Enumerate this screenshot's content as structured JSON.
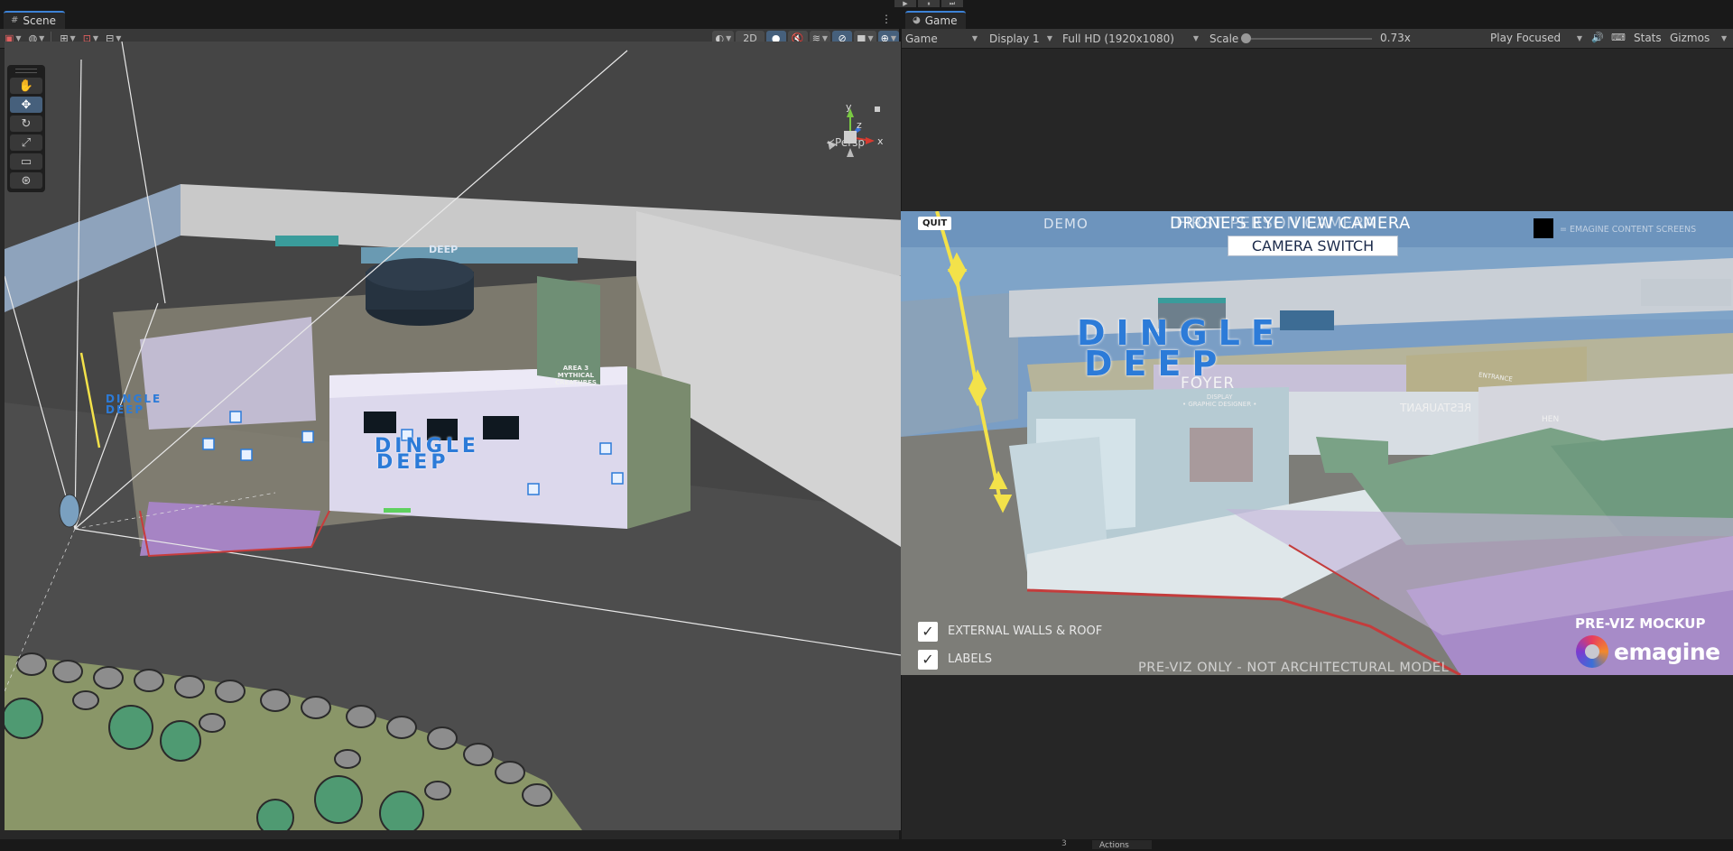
{
  "play_controls": [
    "▶",
    "⏸",
    "⏭"
  ],
  "scene": {
    "tab_label": "Scene",
    "tab_icon": "grid-icon",
    "toolbar": {
      "mode_2d": "2D"
    },
    "tools": [
      "hand-icon",
      "move-icon",
      "rotate-icon",
      "scale-icon",
      "rect-icon",
      "transform-icon"
    ],
    "gizmo": {
      "y": "y",
      "z": "z",
      "x": "x",
      "projection": "≺Persp"
    },
    "in_scene_text": {
      "sign_top": "DEEP",
      "dingle_deep": [
        "DINGLE",
        "DEEP"
      ],
      "area3": [
        "AREA 3",
        "MYTHICAL",
        "CREATURES"
      ],
      "dingle_small": [
        "DINGLE",
        "DEEP"
      ]
    }
  },
  "game": {
    "tab_label": "Game",
    "toolbar": {
      "game_select": "Game",
      "display": "Display 1",
      "resolution": "Full HD (1920x1080)",
      "scale_label": "Scale",
      "scale_value": "0.73x",
      "scale_fraction": 0.0,
      "play_focus": "Play Focused",
      "stats": "Stats",
      "gizmos": "Gizmos"
    },
    "hud": {
      "quit": "QUIT",
      "demo": "DEMO",
      "title_a": "DRONE'S EYE VIEW CAMERA",
      "title_b": "FIRST PERSON CAMERA",
      "camera_switch": "CAMERA SWITCH",
      "content_screens": "= EMAGINE CONTENT SCREENS",
      "toggles": [
        {
          "label": "EXTERNAL WALLS & ROOF",
          "checked": true
        },
        {
          "label": "LABELS",
          "checked": true
        }
      ],
      "previz_only": "PRE-VIZ ONLY - NOT ARCHITECTURAL MODEL",
      "mockup": "PRE-VIZ MOCKUP",
      "brand": "emagine"
    },
    "in_scene_text": {
      "dingle_deep": [
        "DINGLE",
        "DEEP"
      ],
      "foyer": "FOYER",
      "restaurant": "RESTAURANT",
      "kitchen": "HEN",
      "entrance": "ENTRANCE",
      "display": [
        "DISPLAY",
        "• GRAPHIC DESIGNER •"
      ]
    }
  },
  "bottom": {
    "actions_tab": "Actions",
    "badge": "3"
  },
  "colors": {
    "accent": "#3d82d6",
    "active_btn": "#46607c",
    "dingle_blue": "#2c7bd8",
    "arrow_yellow": "#f3e24a"
  }
}
